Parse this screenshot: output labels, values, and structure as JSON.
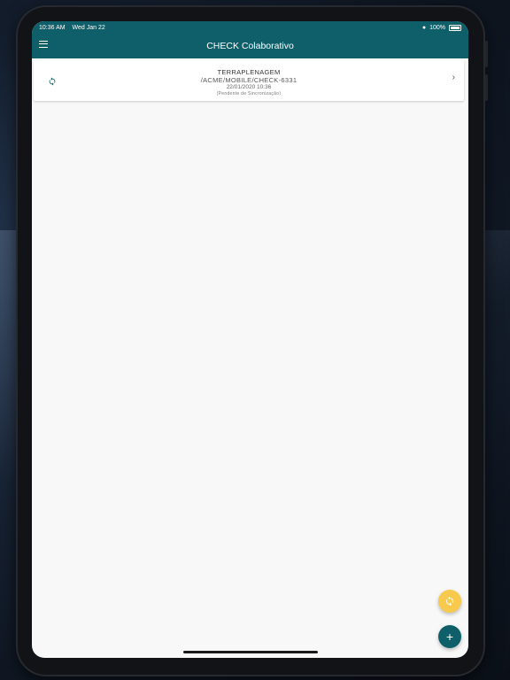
{
  "status_bar": {
    "time": "10:36 AM",
    "date": "Wed Jan 22",
    "battery": "100%"
  },
  "app_bar": {
    "title": "CHECK Colaborativo",
    "menu_icon": "menu-icon"
  },
  "list": {
    "items": [
      {
        "line1": "TERRAPLENAGEM",
        "line2": "/ACME/MOBILE/CHECK-6331",
        "line3": "22/01/2020 10:36",
        "line4": "(Pendente de Sincronização)",
        "icon": "sync-icon",
        "trailing_icon": "chevron-right-icon"
      }
    ]
  },
  "fabs": {
    "sync_icon": "sync-icon",
    "add_label": "+"
  },
  "colors": {
    "primary": "#0e5f6a",
    "accent": "#f7c94c",
    "surface": "#f8f8f8"
  }
}
